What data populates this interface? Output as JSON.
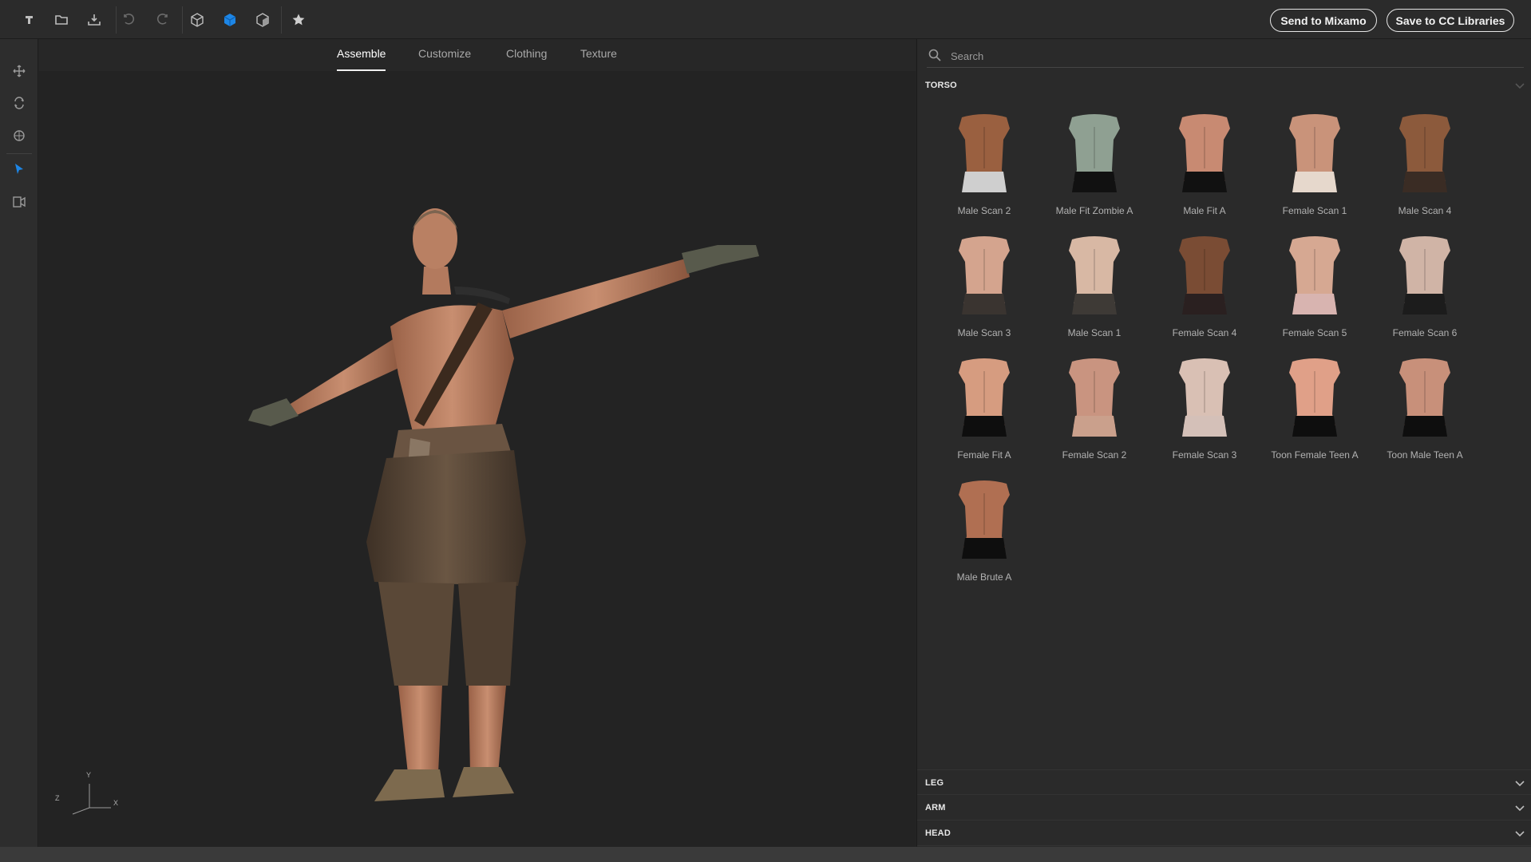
{
  "toolbar": {
    "icons": [
      "new-file-icon",
      "open-folder-icon",
      "save-download-icon",
      "undo-icon",
      "redo-icon",
      "cube-outline-icon",
      "cube-solid-icon",
      "cube-shaded-icon",
      "star-icon"
    ],
    "send_label": "Send to Mixamo",
    "save_label": "Save to CC Libraries"
  },
  "rail": {
    "icons": [
      "move-icon",
      "rotate-icon",
      "target-icon",
      "pointer-icon",
      "camera-icon"
    ]
  },
  "viewport": {
    "tabs": [
      {
        "label": "Assemble",
        "active": true
      },
      {
        "label": "Customize",
        "active": false
      },
      {
        "label": "Clothing",
        "active": false
      },
      {
        "label": "Texture",
        "active": false
      }
    ],
    "axis": {
      "y": "Y",
      "z": "Z",
      "x": "X"
    }
  },
  "panel": {
    "search_placeholder": "Search",
    "torso_title": "TORSO",
    "items": [
      {
        "label": "Male Scan 2",
        "skin": "#9a6040",
        "bottom": "#cfcfcf"
      },
      {
        "label": "Male Fit Zombie A",
        "skin": "#8fa092",
        "bottom": "#111111"
      },
      {
        "label": "Male Fit A",
        "skin": "#c88a72",
        "bottom": "#111111"
      },
      {
        "label": "Female Scan 1",
        "skin": "#c9937a",
        "bottom": "#e6d8cc"
      },
      {
        "label": "Male Scan 4",
        "skin": "#8c5a3c",
        "bottom": "#3a2c24"
      },
      {
        "label": "Male Scan 3",
        "skin": "#d4a48e",
        "bottom": "#3a3430"
      },
      {
        "label": "Male Scan 1",
        "skin": "#d8b8a4",
        "bottom": "#3e3a36"
      },
      {
        "label": "Female Scan 4",
        "skin": "#7a4c34",
        "bottom": "#2a2020"
      },
      {
        "label": "Female Scan 5",
        "skin": "#d6a892",
        "bottom": "#d8b4b0"
      },
      {
        "label": "Female Scan 6",
        "skin": "#d0b4a6",
        "bottom": "#1c1c1c"
      },
      {
        "label": "Female Fit A",
        "skin": "#d69c80",
        "bottom": "#0e0e0e"
      },
      {
        "label": "Female Scan 2",
        "skin": "#c99480",
        "bottom": "#caa08c"
      },
      {
        "label": "Female Scan 3",
        "skin": "#d9c0b4",
        "bottom": "#d4c0b8"
      },
      {
        "label": "Toon Female Teen A",
        "skin": "#e0a088",
        "bottom": "#0e0e0e"
      },
      {
        "label": "Toon Male Teen A",
        "skin": "#c8907a",
        "bottom": "#0e0e0e"
      },
      {
        "label": "Male Brute A",
        "skin": "#b06f52",
        "bottom": "#0e0e0e"
      }
    ],
    "collapsed_sections": [
      "LEG",
      "ARM",
      "HEAD"
    ]
  }
}
